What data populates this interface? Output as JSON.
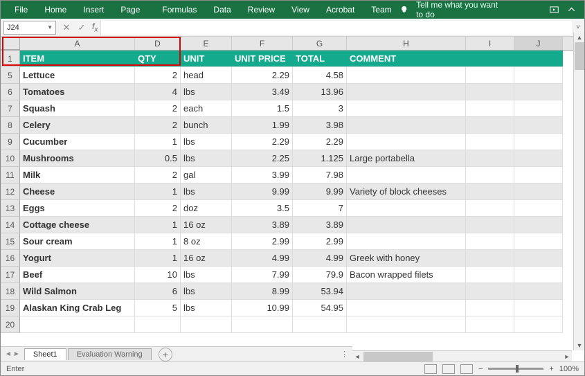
{
  "ribbon": {
    "tabs": [
      "File",
      "Home",
      "Insert",
      "Page Layout",
      "Formulas",
      "Data",
      "Review",
      "View",
      "Acrobat",
      "Team"
    ],
    "tell_me": "Tell me what you want to do"
  },
  "namebox": "J24",
  "columns": [
    "A",
    "D",
    "E",
    "F",
    "G",
    "H",
    "I",
    "J"
  ],
  "header_row": 1,
  "headers": {
    "item": "ITEM",
    "qty": "QTY",
    "unit": "UNIT",
    "price": "UNIT  PRICE",
    "total": "TOTAL",
    "comment": "COMMENT"
  },
  "rows": [
    {
      "n": 5,
      "item": "Lettuce",
      "qty": "2",
      "unit": "head",
      "price": "2.29",
      "total": "4.58",
      "comment": ""
    },
    {
      "n": 6,
      "item": "Tomatoes",
      "qty": "4",
      "unit": "lbs",
      "price": "3.49",
      "total": "13.96",
      "comment": ""
    },
    {
      "n": 7,
      "item": "Squash",
      "qty": "2",
      "unit": "each",
      "price": "1.5",
      "total": "3",
      "comment": ""
    },
    {
      "n": 8,
      "item": "Celery",
      "qty": "2",
      "unit": "bunch",
      "price": "1.99",
      "total": "3.98",
      "comment": ""
    },
    {
      "n": 9,
      "item": "Cucumber",
      "qty": "1",
      "unit": "lbs",
      "price": "2.29",
      "total": "2.29",
      "comment": ""
    },
    {
      "n": 10,
      "item": "Mushrooms",
      "qty": "0.5",
      "unit": "lbs",
      "price": "2.25",
      "total": "1.125",
      "comment": "Large  portabella"
    },
    {
      "n": 11,
      "item": "Milk",
      "qty": "2",
      "unit": "gal",
      "price": "3.99",
      "total": "7.98",
      "comment": ""
    },
    {
      "n": 12,
      "item": "Cheese",
      "qty": "1",
      "unit": "lbs",
      "price": "9.99",
      "total": "9.99",
      "comment": "Variety  of  block  cheeses"
    },
    {
      "n": 13,
      "item": "Eggs",
      "qty": "2",
      "unit": "doz",
      "price": "3.5",
      "total": "7",
      "comment": ""
    },
    {
      "n": 14,
      "item": "Cottage cheese",
      "qty": "1",
      "unit": "16 oz",
      "price": "3.89",
      "total": "3.89",
      "comment": ""
    },
    {
      "n": 15,
      "item": "Sour cream",
      "qty": "1",
      "unit": "8 oz",
      "price": "2.99",
      "total": "2.99",
      "comment": ""
    },
    {
      "n": 16,
      "item": "Yogurt",
      "qty": "1",
      "unit": "16 oz",
      "price": "4.99",
      "total": "4.99",
      "comment": "Greek  with  honey"
    },
    {
      "n": 17,
      "item": "Beef",
      "qty": "10",
      "unit": "lbs",
      "price": "7.99",
      "total": "79.9",
      "comment": "Bacon wrapped  filets"
    },
    {
      "n": 18,
      "item": "Wild  Salmon",
      "qty": "6",
      "unit": "lbs",
      "price": "8.99",
      "total": "53.94",
      "comment": ""
    },
    {
      "n": 19,
      "item": "Alaskan  King  Crab  Leg",
      "qty": "5",
      "unit": "lbs",
      "price": "10.99",
      "total": "54.95",
      "comment": ""
    }
  ],
  "empty_rows": [
    20
  ],
  "sheets": {
    "active": "Sheet1",
    "other": "Evaluation Warning"
  },
  "status": {
    "mode": "Enter",
    "zoom": "100%"
  }
}
